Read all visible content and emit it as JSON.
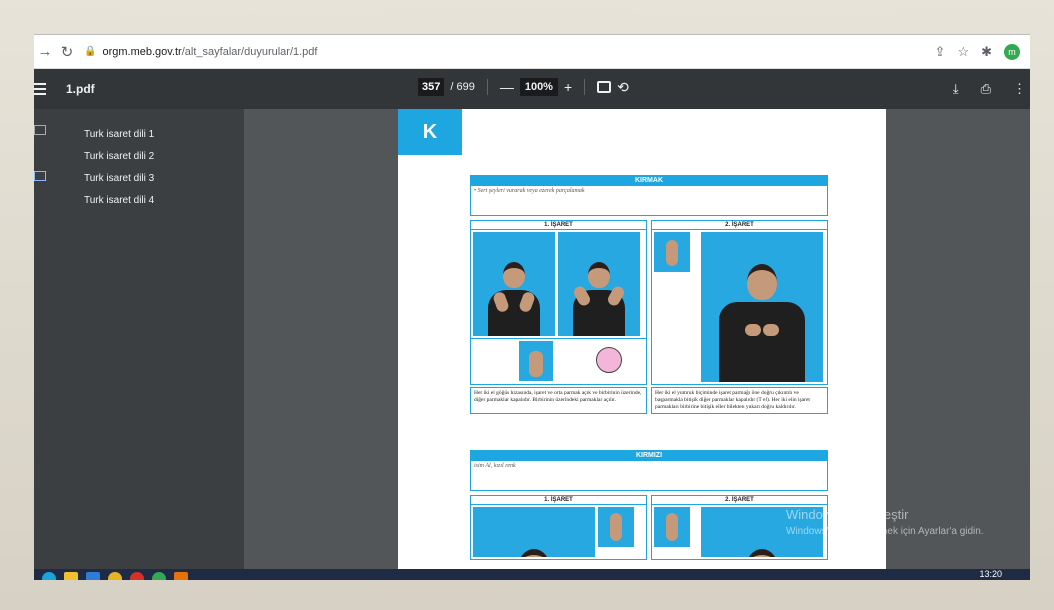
{
  "browser": {
    "url_host": "orgm.meb.gov.tr",
    "url_path": "/alt_sayfalar/duyurular/1.pdf"
  },
  "pdf_toolbar": {
    "title": "1.pdf",
    "current_page": "357",
    "total_pages": "/ 699",
    "zoom": "100%"
  },
  "outline": [
    "Turk isaret dili 1",
    "Turk isaret dili 2",
    "Turk isaret dili 3",
    "Turk isaret dili 4"
  ],
  "page": {
    "letter": "K",
    "entry1": {
      "header": "KIRMAK",
      "definition": "• Sert şeyleri vurarak veya ezerek parçalamak",
      "sign1_label": "1. İŞARET",
      "sign2_label": "2. İŞARET",
      "desc1": "Her iki el göğüs hizasında, işaret ve orta parmak açık ve birbirinin üzerinde, diğer parmaklar kapalıdır. Birbirinin üzerindeki parmaklar açılır.",
      "desc2": "Her iki el yumruk biçiminde işaret parmağı öne doğru çıkıntılı ve başparmakla bitişik diğer parmaklar kapalıdır (T el). Her iki elin işaret parmakları birbirine bitişik eller bilekten yukarı doğru kaldırılır."
    },
    "entry2": {
      "header": "KIRMIZI",
      "definition": "isim Al, kızıl renk",
      "sign1_label": "1. İŞARET",
      "sign2_label": "2. İŞARET"
    }
  },
  "watermark": {
    "line1": "Windows'u Etkinleştir",
    "line2": "Windows'u etkinleştirmek için Ayarlar'a gidin."
  },
  "taskbar": {
    "clock": "13:20"
  },
  "colors": {
    "accent": "#1ea6e0",
    "toolbar": "#323639",
    "sidebar": "#3c3f42",
    "viewer_bg": "#525659"
  }
}
